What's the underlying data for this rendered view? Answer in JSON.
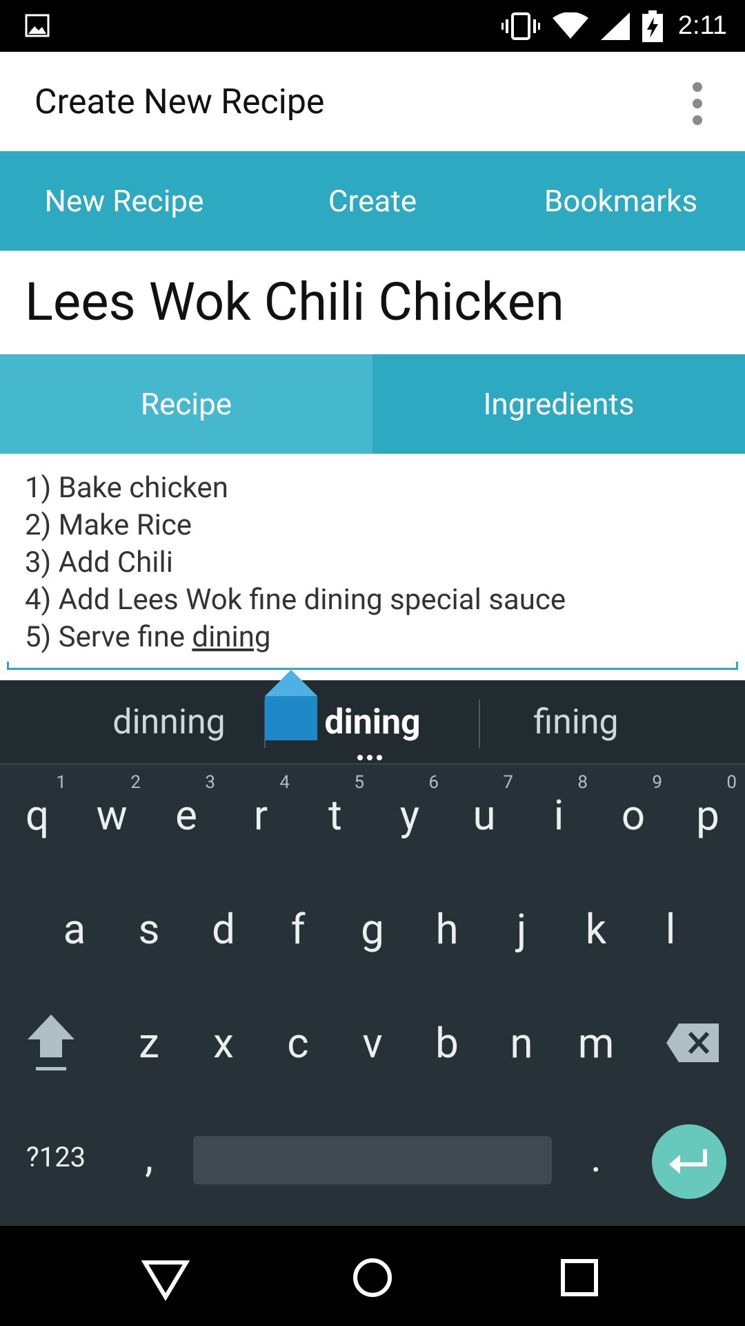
{
  "status_bar": {
    "time": "2:11",
    "icons": [
      "image-icon",
      "vibrate-icon",
      "wifi-icon",
      "signal-icon",
      "battery-charging-icon"
    ]
  },
  "app_bar": {
    "title": "Create New Recipe",
    "overflow_icon": "more-vert-icon"
  },
  "main_nav": {
    "tabs": [
      {
        "label": "New Recipe"
      },
      {
        "label": "Create"
      },
      {
        "label": "Bookmarks"
      }
    ]
  },
  "recipe": {
    "title": "Lees Wok Chili Chicken"
  },
  "sub_tabs": {
    "tabs": [
      {
        "label": "Recipe",
        "active": true
      },
      {
        "label": "Ingredients",
        "active": false
      }
    ]
  },
  "editor": {
    "lines": [
      "1) Bake chicken",
      "2) Make Rice",
      "3) Add Chili",
      "4) Add Lees Wok fine dining special sauce"
    ],
    "last_line_prefix": "5) Serve fine ",
    "last_line_word": "dining"
  },
  "keyboard": {
    "suggestions": [
      "dinning",
      "dining",
      "fining"
    ],
    "row1": [
      {
        "key": "q",
        "hint": "1"
      },
      {
        "key": "w",
        "hint": "2"
      },
      {
        "key": "e",
        "hint": "3"
      },
      {
        "key": "r",
        "hint": "4"
      },
      {
        "key": "t",
        "hint": "5"
      },
      {
        "key": "y",
        "hint": "6"
      },
      {
        "key": "u",
        "hint": "7"
      },
      {
        "key": "i",
        "hint": "8"
      },
      {
        "key": "o",
        "hint": "9"
      },
      {
        "key": "p",
        "hint": "0"
      }
    ],
    "row2": [
      "a",
      "s",
      "d",
      "f",
      "g",
      "h",
      "j",
      "k",
      "l"
    ],
    "row3": [
      "z",
      "x",
      "c",
      "v",
      "b",
      "n",
      "m"
    ],
    "symbols_label": "?123",
    "comma": ",",
    "period": ".",
    "accent_color": "#66c9bc"
  },
  "colors": {
    "primary": "#2ea9c2",
    "tab_active": "#46b8cd",
    "keyboard_bg": "#263238"
  }
}
